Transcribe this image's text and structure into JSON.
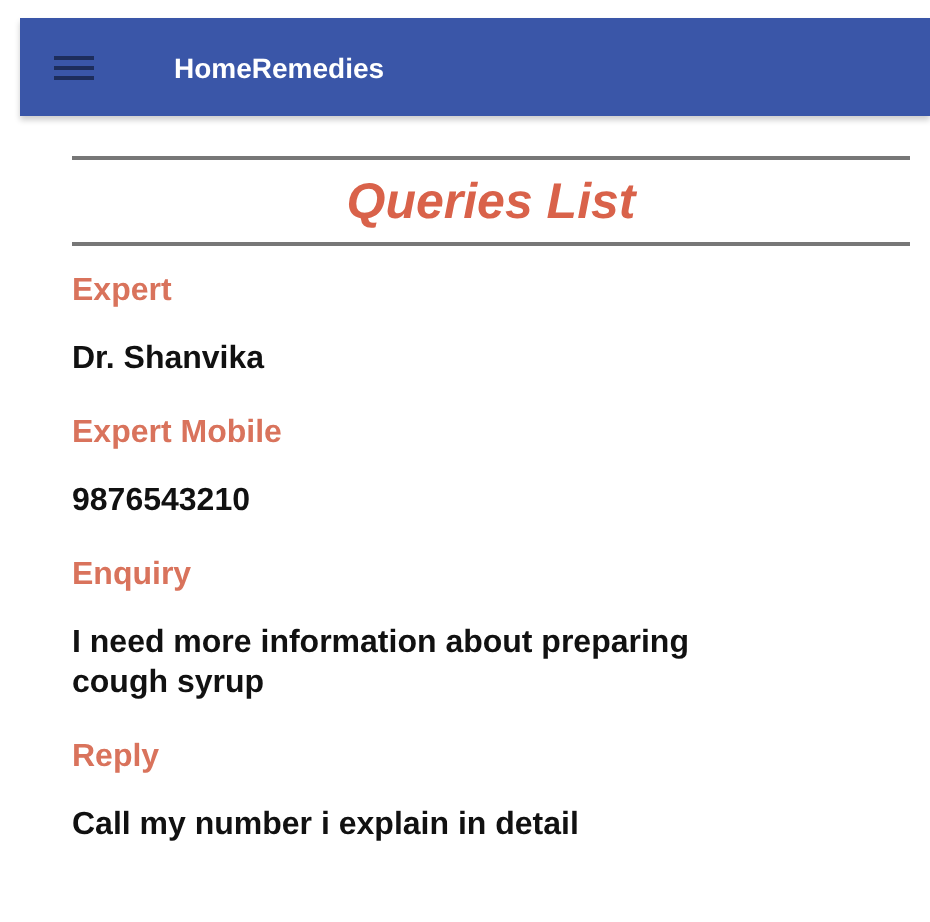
{
  "app_bar": {
    "title": "HomeRemedies"
  },
  "heading": "Queries List",
  "fields": [
    {
      "label": "Expert",
      "value": "Dr. Shanvika"
    },
    {
      "label": "Expert Mobile",
      "value": "9876543210"
    },
    {
      "label": "Enquiry",
      "value": "I need more information about preparing cough syrup"
    },
    {
      "label": "Reply",
      "value": "Call my number i explain in detail"
    }
  ]
}
